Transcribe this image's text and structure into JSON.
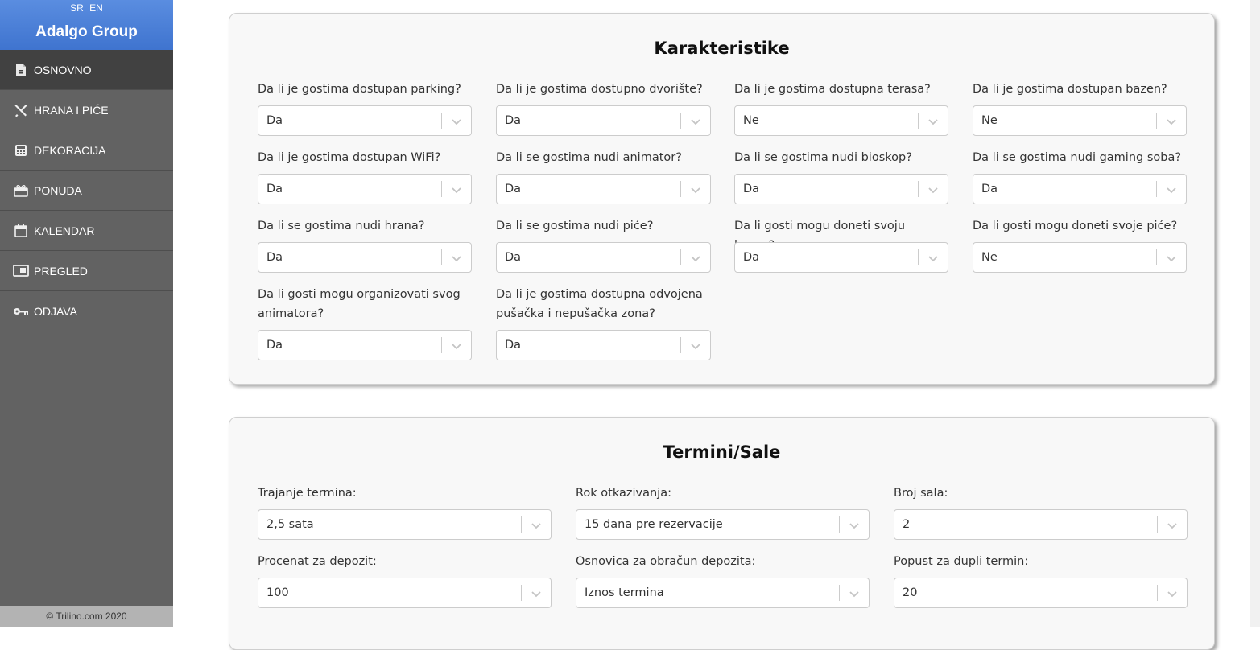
{
  "sidebar": {
    "lang": [
      "SR",
      "EN"
    ],
    "brand": "Adalgo Group",
    "items": [
      {
        "label": "OSNOVNO",
        "icon": "document-icon"
      },
      {
        "label": "HRANA I PIĆE",
        "icon": "utensils-icon"
      },
      {
        "label": "DEKORACIJA",
        "icon": "calculator-icon"
      },
      {
        "label": "PONUDA",
        "icon": "gift-icon"
      },
      {
        "label": "KALENDAR",
        "icon": "calendar-icon"
      },
      {
        "label": "PREGLED",
        "icon": "monitor-icon"
      },
      {
        "label": "ODJAVA",
        "icon": "key-icon"
      }
    ],
    "footer": "© Trilino.com 2020"
  },
  "karakteristike": {
    "title": "Karakteristike",
    "fields": [
      {
        "label": "Da li je gostima dostupan parking?",
        "value": "Da"
      },
      {
        "label": "Da li je gostima dostupno dvorište?",
        "value": "Da"
      },
      {
        "label": "Da li je gostima dostupna terasa?",
        "value": "Ne"
      },
      {
        "label": "Da li je gostima dostupan bazen?",
        "value": "Ne"
      },
      {
        "label": "Da li je gostima dostupan WiFi?",
        "value": "Da"
      },
      {
        "label": "Da li se gostima nudi animator?",
        "value": "Da"
      },
      {
        "label": "Da li se gostima nudi bioskop?",
        "value": "Da"
      },
      {
        "label": "Da li se gostima nudi gaming soba?",
        "value": "Da"
      },
      {
        "label": "Da li se gostima nudi hrana?",
        "value": "Da"
      },
      {
        "label": "Da li se gostima nudi piće?",
        "value": "Da"
      },
      {
        "label": "Da li gosti mogu doneti svoju hranu?",
        "value": "Da"
      },
      {
        "label": "Da li gosti mogu doneti svoje piće?",
        "value": "Ne"
      },
      {
        "label": "Da li gosti mogu organizovati svog",
        "label2": "animatora?",
        "value": "Da"
      },
      {
        "label": "Da li je gostima dostupna odvojena",
        "label2": "pušačka i nepušačka zona?",
        "value": "Da"
      }
    ]
  },
  "termini": {
    "title": "Termini/Sale",
    "fields": [
      {
        "label": "Trajanje termina:",
        "value": "2,5 sata"
      },
      {
        "label": "Rok otkazivanja:",
        "value": "15 dana pre rezervacije"
      },
      {
        "label": "Broj sala:",
        "value": "2"
      },
      {
        "label": "Procenat za depozit:",
        "value": "100"
      },
      {
        "label": "Osnovica za obračun depozita:",
        "value": "Iznos termina"
      },
      {
        "label": "Popust za dupli termin:",
        "value": "20"
      }
    ]
  }
}
